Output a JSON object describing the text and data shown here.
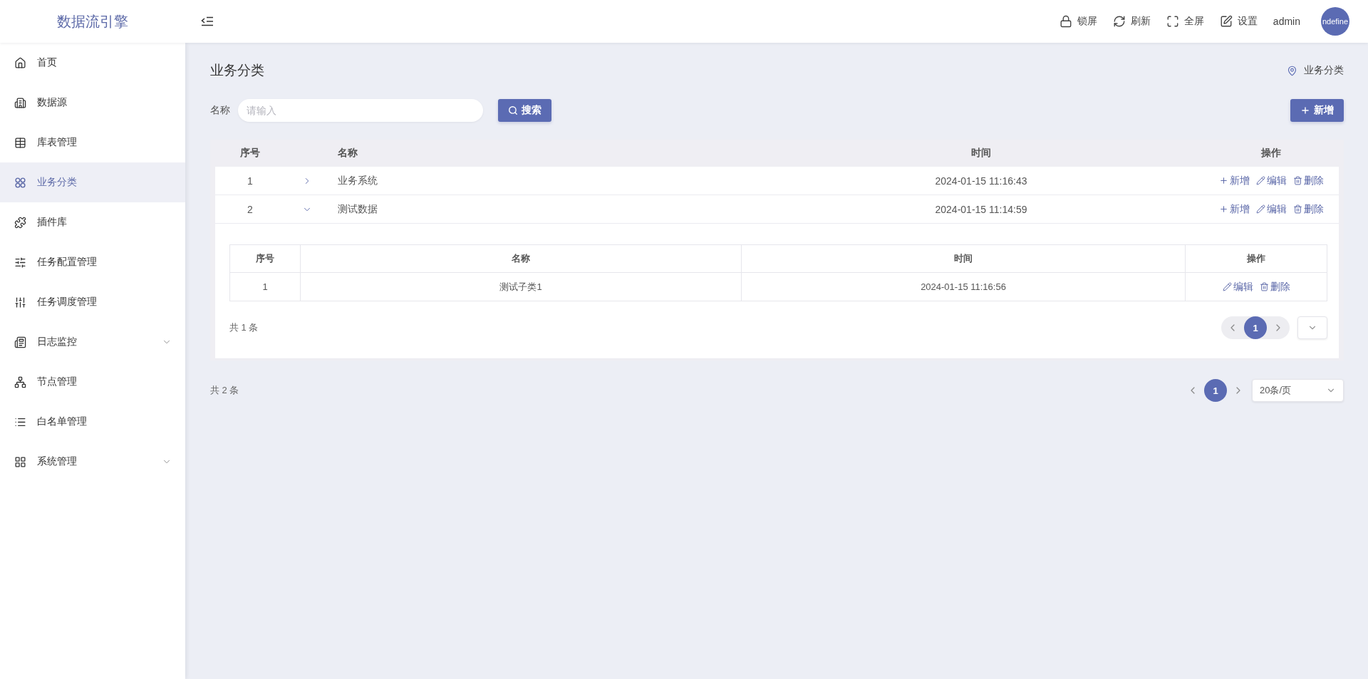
{
  "header": {
    "logo": "数据流引擎",
    "toolbar": [
      {
        "kind": "lock",
        "label": "锁屏"
      },
      {
        "kind": "refresh",
        "label": "刷新"
      },
      {
        "kind": "fullscreen",
        "label": "全屏"
      },
      {
        "kind": "settings",
        "label": "设置"
      }
    ],
    "username": "admin",
    "avatar_text": "ndefine"
  },
  "sidebar": {
    "items": [
      {
        "label": "首页",
        "selected": false,
        "submenu": false
      },
      {
        "label": "数据源",
        "selected": false,
        "submenu": false
      },
      {
        "label": "库表管理",
        "selected": false,
        "submenu": false
      },
      {
        "label": "业务分类",
        "selected": true,
        "submenu": false
      },
      {
        "label": "插件库",
        "selected": false,
        "submenu": false
      },
      {
        "label": "任务配置管理",
        "selected": false,
        "submenu": false
      },
      {
        "label": "任务调度管理",
        "selected": false,
        "submenu": false
      },
      {
        "label": "日志监控",
        "selected": false,
        "submenu": true
      },
      {
        "label": "节点管理",
        "selected": false,
        "submenu": false
      },
      {
        "label": "白名单管理",
        "selected": false,
        "submenu": false
      },
      {
        "label": "系统管理",
        "selected": false,
        "submenu": true
      }
    ]
  },
  "page": {
    "title": "业务分类",
    "breadcrumb": "业务分类"
  },
  "filter": {
    "label": "名称",
    "placeholder": "请输入",
    "search_button": "搜索",
    "add_button": "新增"
  },
  "table": {
    "columns": [
      "序号",
      "名称",
      "时间",
      "操作"
    ],
    "rows": [
      {
        "index": "1",
        "name": "业务系统",
        "time": "2024-01-15 11:16:43",
        "expanded": false,
        "actions": [
          {
            "kind": "add",
            "label": "新增"
          },
          {
            "kind": "edit",
            "label": "编辑"
          },
          {
            "kind": "delete",
            "label": "删除"
          }
        ]
      },
      {
        "index": "2",
        "name": "测试数据",
        "time": "2024-01-15 11:14:59",
        "expanded": true,
        "actions": [
          {
            "kind": "add",
            "label": "新增"
          },
          {
            "kind": "edit",
            "label": "编辑"
          },
          {
            "kind": "delete",
            "label": "删除"
          }
        ],
        "children": {
          "columns": [
            "序号",
            "名称",
            "时间",
            "操作"
          ],
          "rows": [
            {
              "index": "1",
              "name": "测试子类1",
              "time": "2024-01-15 11:16:56",
              "actions": [
                {
                  "kind": "edit",
                  "label": "编辑"
                },
                {
                  "kind": "delete",
                  "label": "删除"
                }
              ]
            }
          ],
          "total": "共 1 条",
          "pagination": {
            "pages": [
              {
                "label": "1",
                "selected": true
              }
            ]
          }
        }
      }
    ],
    "total": "共 2 条",
    "pagination": {
      "pages": [
        {
          "label": "1",
          "selected": true
        }
      ],
      "page_size": "20条/页"
    }
  }
}
